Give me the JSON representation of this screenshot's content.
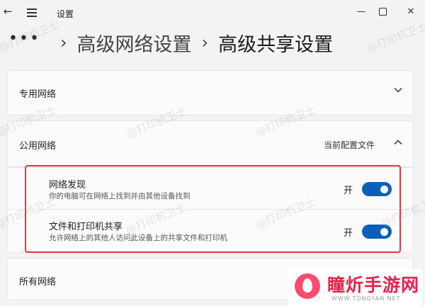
{
  "titlebar": {
    "app_title": "设置",
    "back_icon": "←",
    "minimize_icon": "—",
    "close_icon": "✕"
  },
  "breadcrumb": {
    "more": "•••",
    "separator": "›",
    "parent": "高级网络设置",
    "current": "高级共享设置"
  },
  "sections": {
    "private": {
      "label": "专用网络",
      "expanded": false
    },
    "public": {
      "label": "公用网络",
      "status": "当前配置文件",
      "expanded": true
    },
    "all": {
      "label": "所有网络",
      "expanded": false
    }
  },
  "settings": [
    {
      "title": "网络发现",
      "description": "你的电脑可在网络上找到并由其他设备找到",
      "state_label": "开",
      "on": true
    },
    {
      "title": "文件和打印机共享",
      "description": "允许网络上的其他人访问此设备上的共享文件和打印机",
      "state_label": "开",
      "on": true
    }
  ],
  "highlight_color": "#e0393e",
  "accent_color": "#0b5fb8",
  "watermark": "@打印机卫士",
  "logo": {
    "name": "瞳炘手游网",
    "url": "WWW.TONGYAN.NET",
    "color": "#e8204a"
  }
}
